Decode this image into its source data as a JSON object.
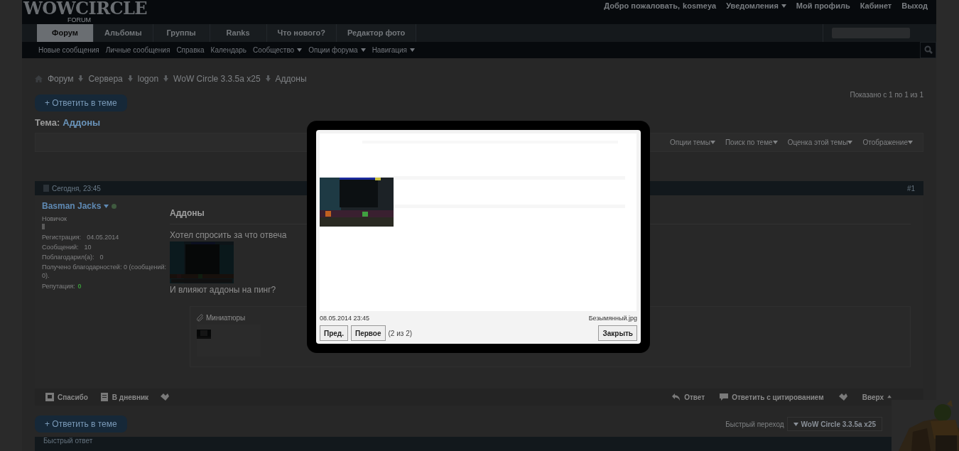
{
  "header": {
    "logo": "WOWCIRCLE",
    "logo_sub": "FORUM",
    "welcome": "Добро пожаловать,",
    "username": "kosmeya",
    "user_links": [
      {
        "label": "Уведомления",
        "dropdown": true
      },
      {
        "label": "Мой профиль",
        "dropdown": false
      },
      {
        "label": "Кабинет",
        "dropdown": false
      },
      {
        "label": "Выход",
        "dropdown": false
      }
    ]
  },
  "tabs": [
    {
      "label": "Форум",
      "selected": true
    },
    {
      "label": "Альбомы",
      "selected": false
    },
    {
      "label": "Группы",
      "selected": false
    },
    {
      "label": "Ranks",
      "selected": false
    },
    {
      "label": "Что нового?",
      "selected": false
    },
    {
      "label": "Редактор фото",
      "selected": false
    }
  ],
  "subnav": [
    {
      "label": "Новые сообщения",
      "dropdown": false
    },
    {
      "label": "Личные сообщения",
      "dropdown": false
    },
    {
      "label": "Справка",
      "dropdown": false
    },
    {
      "label": "Календарь",
      "dropdown": false
    },
    {
      "label": "Сообщество",
      "dropdown": true
    },
    {
      "label": "Опции форума",
      "dropdown": true
    },
    {
      "label": "Навигация",
      "dropdown": true
    }
  ],
  "breadcrumbs": [
    "Форум",
    "Сервера",
    "logon",
    "WoW Circle 3.3.5a x25",
    "Аддоны"
  ],
  "reply_button": "+ Ответить в теме",
  "pagination_info": "Показано с 1 по 1 из 1",
  "thread": {
    "label": "Тема:",
    "title": "Аддоны"
  },
  "thread_tools": [
    "Опции темы",
    "Поиск по теме",
    "Оценка этой темы",
    "Отображение"
  ],
  "post": {
    "date": "Сегодня, 23:45",
    "number": "#1",
    "author": "Basman Jacks",
    "rank": "Новичок",
    "stats": [
      {
        "label": "Регистрация:",
        "value": "04.05.2014"
      },
      {
        "label": "Сообщений:",
        "value": "10"
      },
      {
        "label": "Поблагодарил(а):",
        "value": "0"
      }
    ],
    "thanks_received": "Получено благодарностей: 0 (сообщений: 0).",
    "reputation_label": "Репутация:",
    "reputation": "0",
    "title": "Аддоны",
    "text_1": "Хотел спросить за что отвеча",
    "text_2": "И влияют аддоны на пинг?",
    "attachments_label": "Миниатюры",
    "actions_left": [
      {
        "kind": "thanks",
        "label": "Спасибо"
      },
      {
        "kind": "diary",
        "label": "В дневник"
      },
      {
        "kind": "icon"
      }
    ],
    "actions_right": [
      {
        "kind": "reply",
        "label": "Ответ"
      },
      {
        "kind": "quote",
        "label": "Ответить с цитированием"
      },
      {
        "kind": "icon"
      },
      {
        "kind": "top",
        "label": "Вверх"
      }
    ]
  },
  "reply_button_bottom": "+ Ответить в теме",
  "quick_nav": {
    "label": "Быстрый переход",
    "value": "WoW Circle 3.3.5a x25"
  },
  "quick_reply": "Быстрый ответ",
  "lightbox": {
    "date": "08.05.2014 23:45",
    "filename": "Безымянный.jpg",
    "buttons": [
      "Пред.",
      "Первое"
    ],
    "counter": "(2 из 2)",
    "close": "Закрыть"
  }
}
